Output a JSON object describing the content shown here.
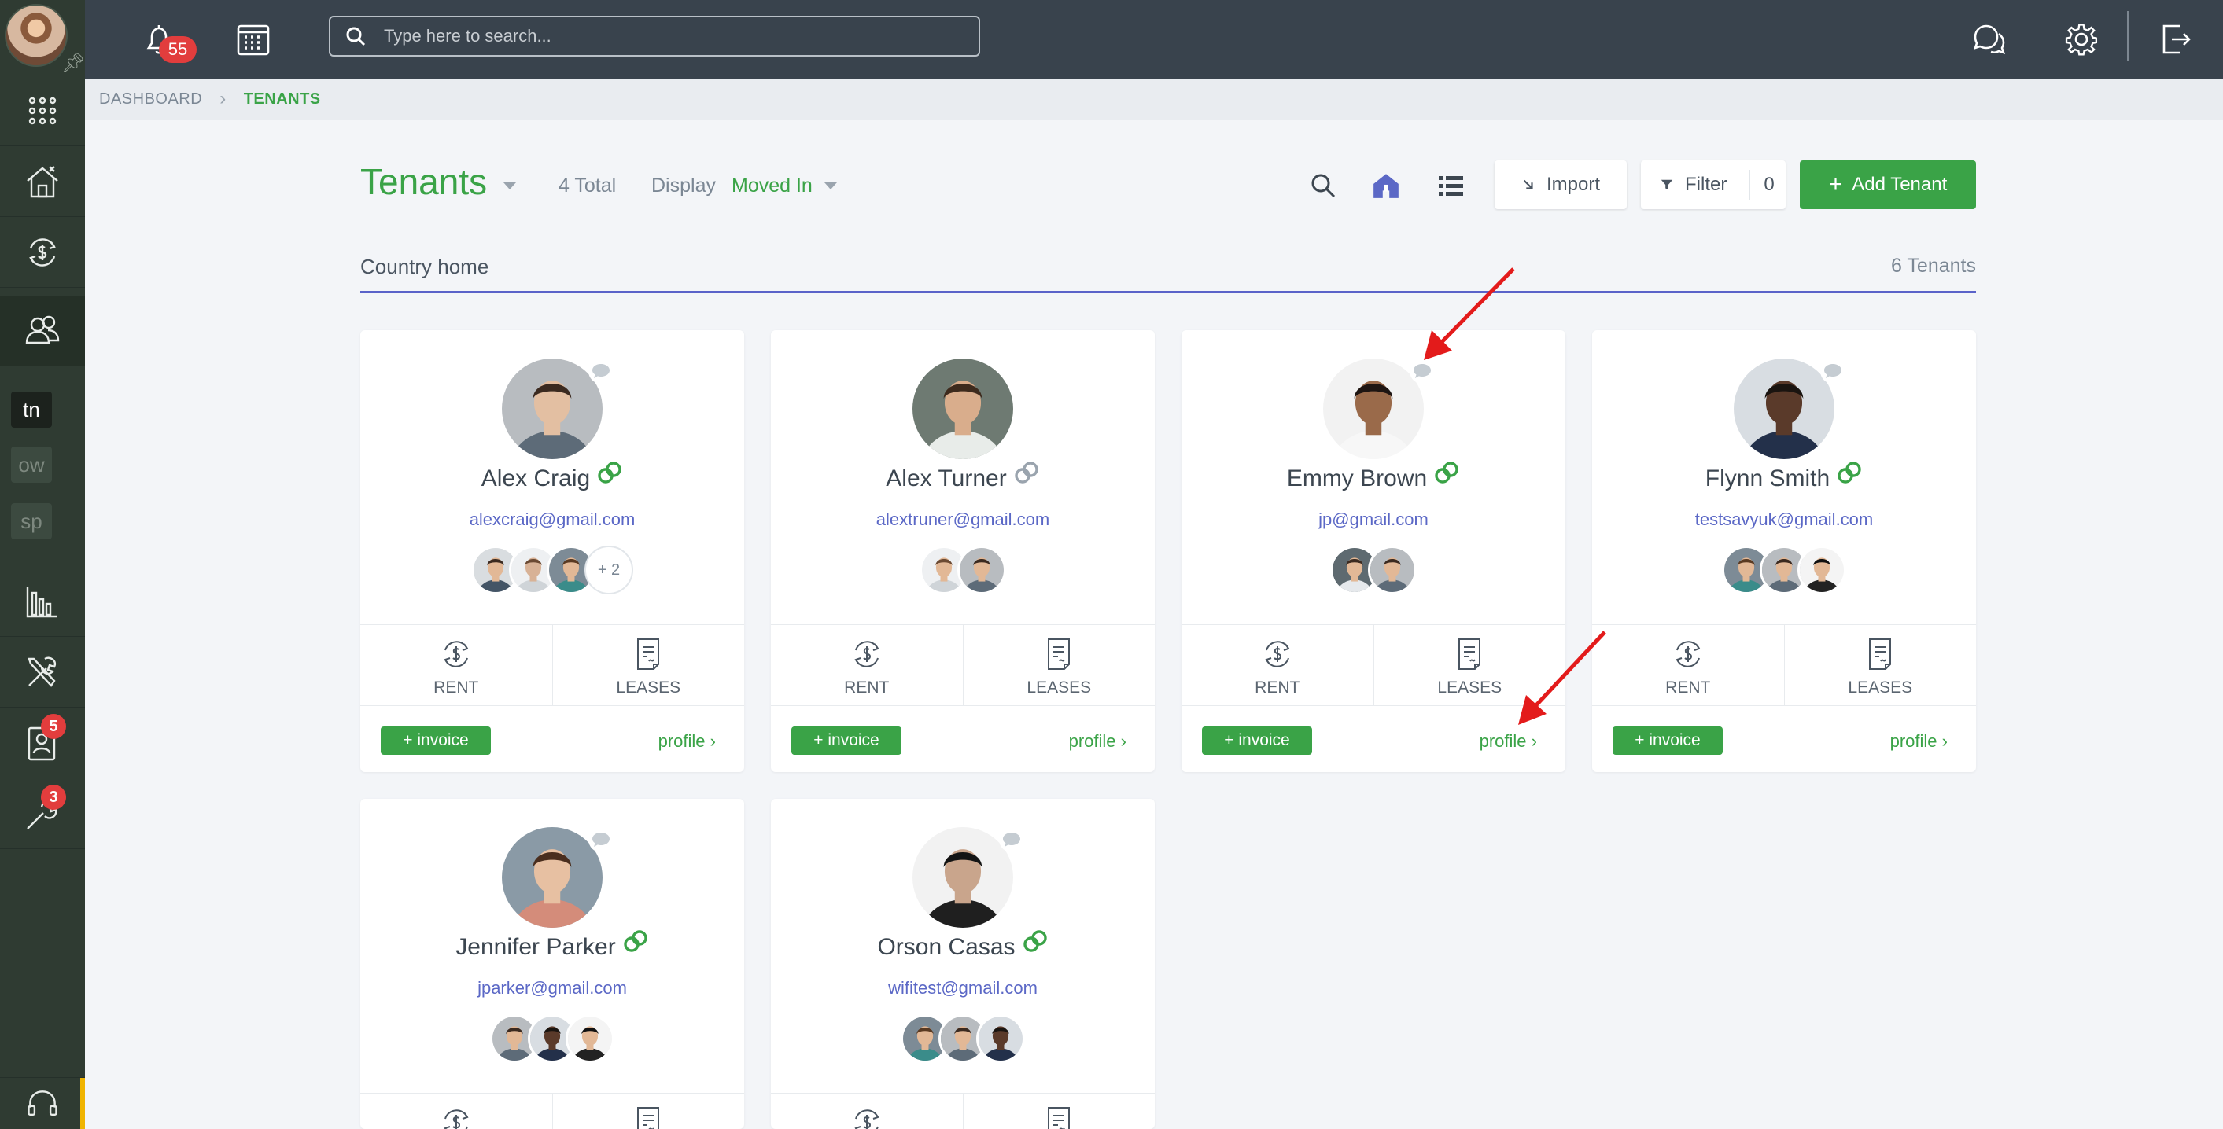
{
  "topbar": {
    "notification_count": "55",
    "search_placeholder": "Type here to search..."
  },
  "sidebar": {
    "tags": [
      {
        "label": "tn",
        "bg": "#1c221d",
        "color": "#ffffff"
      },
      {
        "label": "ow",
        "bg": "#3c4a40",
        "color": "#7d887f"
      },
      {
        "label": "sp",
        "bg": "#3c4a40",
        "color": "#7d887f"
      }
    ],
    "badge_tenants_screening": "5",
    "badge_maintenance": "3"
  },
  "breadcrumb": {
    "items": [
      "DASHBOARD",
      "TENANTS"
    ]
  },
  "header": {
    "title": "Tenants",
    "total": "4 Total",
    "display_label": "Display",
    "display_value": "Moved In",
    "import_label": "Import",
    "filter_label": "Filter",
    "filter_count": "0",
    "add_label": "Add Tenant"
  },
  "group": {
    "name": "Country home",
    "count": "6 Tenants"
  },
  "card_labels": {
    "rent": "RENT",
    "leases": "LEASES",
    "invoice": "+ invoice",
    "profile": "profile"
  },
  "tenants": [
    {
      "name": "Alex Craig",
      "email": "alexcraig@gmail.com",
      "linked": true,
      "extra_count": "+ 2"
    },
    {
      "name": "Alex Turner",
      "email": "alextruner@gmail.com",
      "linked": false
    },
    {
      "name": "Emmy Brown",
      "email": "jp@gmail.com",
      "linked": true
    },
    {
      "name": "Flynn Smith",
      "email": "testsavyuk@gmail.com",
      "linked": true
    },
    {
      "name": "Jennifer Parker",
      "email": "jparker@gmail.com",
      "linked": true
    },
    {
      "name": "Orson Casas",
      "email": "wifitest@gmail.com",
      "linked": true
    }
  ],
  "colors": {
    "brand_green": "#3aa347",
    "accent_blue": "#5b68c6",
    "badge_red": "#e23d3d",
    "annotation_arrow": "#e31b1b"
  }
}
